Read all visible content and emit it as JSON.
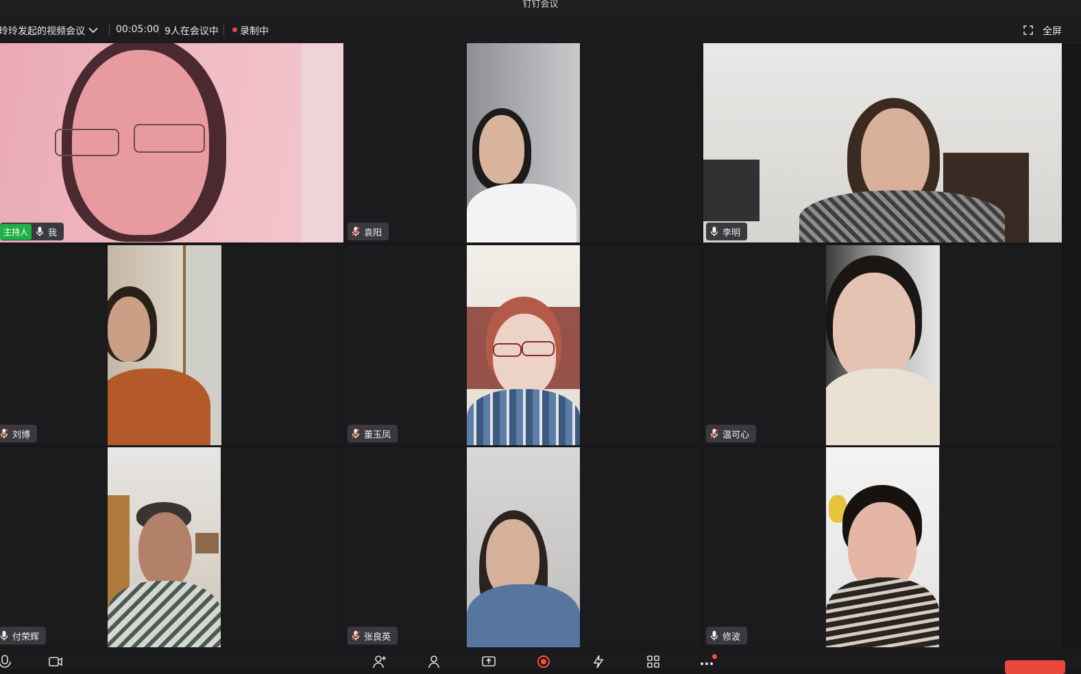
{
  "window": {
    "title": "钉钉会议"
  },
  "toolbar": {
    "meeting_title": "玲玲发起的视频会议",
    "duration": "00:05:00",
    "participant_count": "9人在会议中",
    "recording_label": "录制中",
    "fullscreen_label": "全屏"
  },
  "participants": [
    {
      "name": "我",
      "mic": "on",
      "host_label": "主持人"
    },
    {
      "name": "袁阳",
      "mic": "off"
    },
    {
      "name": "李明",
      "mic": "on"
    },
    {
      "name": "刘博",
      "mic": "off"
    },
    {
      "name": "董玉凤",
      "mic": "off"
    },
    {
      "name": "温可心",
      "mic": "off"
    },
    {
      "name": "付荣辉",
      "mic": "on"
    },
    {
      "name": "张良英",
      "mic": "off"
    },
    {
      "name": "修波",
      "mic": "on"
    }
  ],
  "bottom_controls": [
    {
      "icon": "microphone-icon"
    },
    {
      "icon": "camera-icon"
    },
    {
      "icon": "invite-member-icon"
    },
    {
      "icon": "members-icon"
    },
    {
      "icon": "share-screen-icon"
    },
    {
      "icon": "record-icon"
    },
    {
      "icon": "interaction-icon"
    },
    {
      "icon": "apps-icon"
    },
    {
      "icon": "more-icon"
    }
  ],
  "colors": {
    "host_badge": "#20b04a",
    "recording": "#e84545",
    "leave": "#e8493a"
  }
}
